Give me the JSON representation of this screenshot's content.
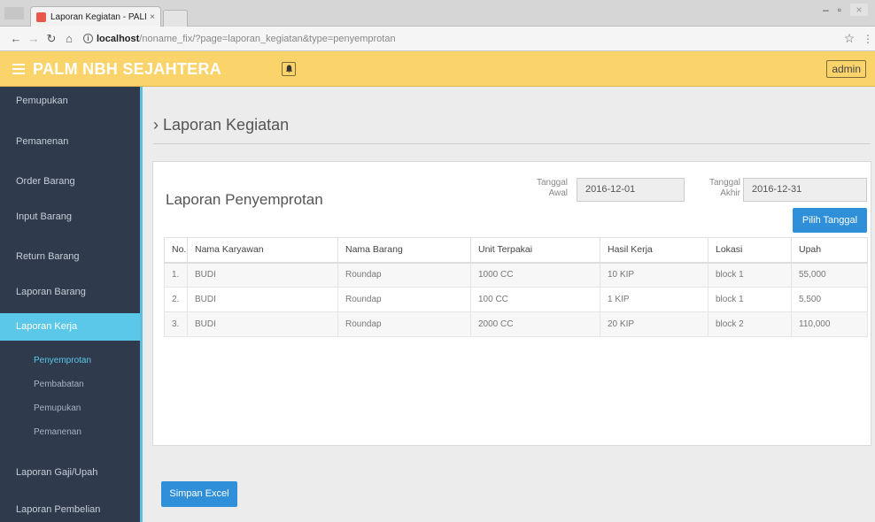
{
  "browser": {
    "tab_title": "Laporan Kegiatan - PALI",
    "tab_close": "×",
    "url_host": "localhost",
    "url_path": "/noname_fix/?page=laporan_kegiatan&type=penyemprotan",
    "info_glyph": "i"
  },
  "header": {
    "brand": "PALM NBH SEJAHTERA",
    "admin_label": "admin"
  },
  "sidebar": {
    "items": [
      {
        "label": "Pemupukan"
      },
      {
        "label": "Pemanenan"
      },
      {
        "label": "Order Barang"
      },
      {
        "label": "Input Barang"
      },
      {
        "label": "Return Barang"
      },
      {
        "label": "Laporan Barang"
      },
      {
        "label": "Laporan Kerja"
      },
      {
        "label": "Laporan Gaji/Upah"
      },
      {
        "label": "Laporan Pembelian"
      }
    ],
    "subitems": [
      {
        "label": "Penyemprotan"
      },
      {
        "label": "Pembabatan"
      },
      {
        "label": "Pemupukan"
      },
      {
        "label": "Pemanenan"
      }
    ]
  },
  "main": {
    "page_title": "› Laporan Kegiatan",
    "panel_title": "Laporan Penyemprotan",
    "tanggal_awal_label_1": "Tanggal",
    "tanggal_awal_label_2": "Awal",
    "tanggal_awal_value": "2016-12-01",
    "tanggal_akhir_label_1": "Tanggal",
    "tanggal_akhir_label_2": "Akhir",
    "tanggal_akhir_value": "2016-12-31",
    "pick_button": "Pilih Tanggal",
    "excel_button": "Simpan Excel",
    "table": {
      "headers": [
        "No.",
        "Nama Karyawan",
        "Nama Barang",
        "Unit Terpakai",
        "Hasil Kerja",
        "Lokasi",
        "Upah"
      ],
      "rows": [
        [
          "1.",
          "BUDI",
          "Roundap",
          "1000 CC",
          "10 KIP",
          "block 1",
          "55,000"
        ],
        [
          "2.",
          "BUDI",
          "Roundap",
          "100 CC",
          "1 KIP",
          "block 1",
          "5,500"
        ],
        [
          "3.",
          "BUDI",
          "Roundap",
          "2000 CC",
          "20 KIP",
          "block 2",
          "110,000"
        ]
      ]
    }
  },
  "colors": {
    "header_bg": "#fbd36b",
    "sidebar_bg": "#2f3a4c",
    "sidebar_active": "#5bc8ea",
    "button_blue": "#2f8fd8"
  }
}
